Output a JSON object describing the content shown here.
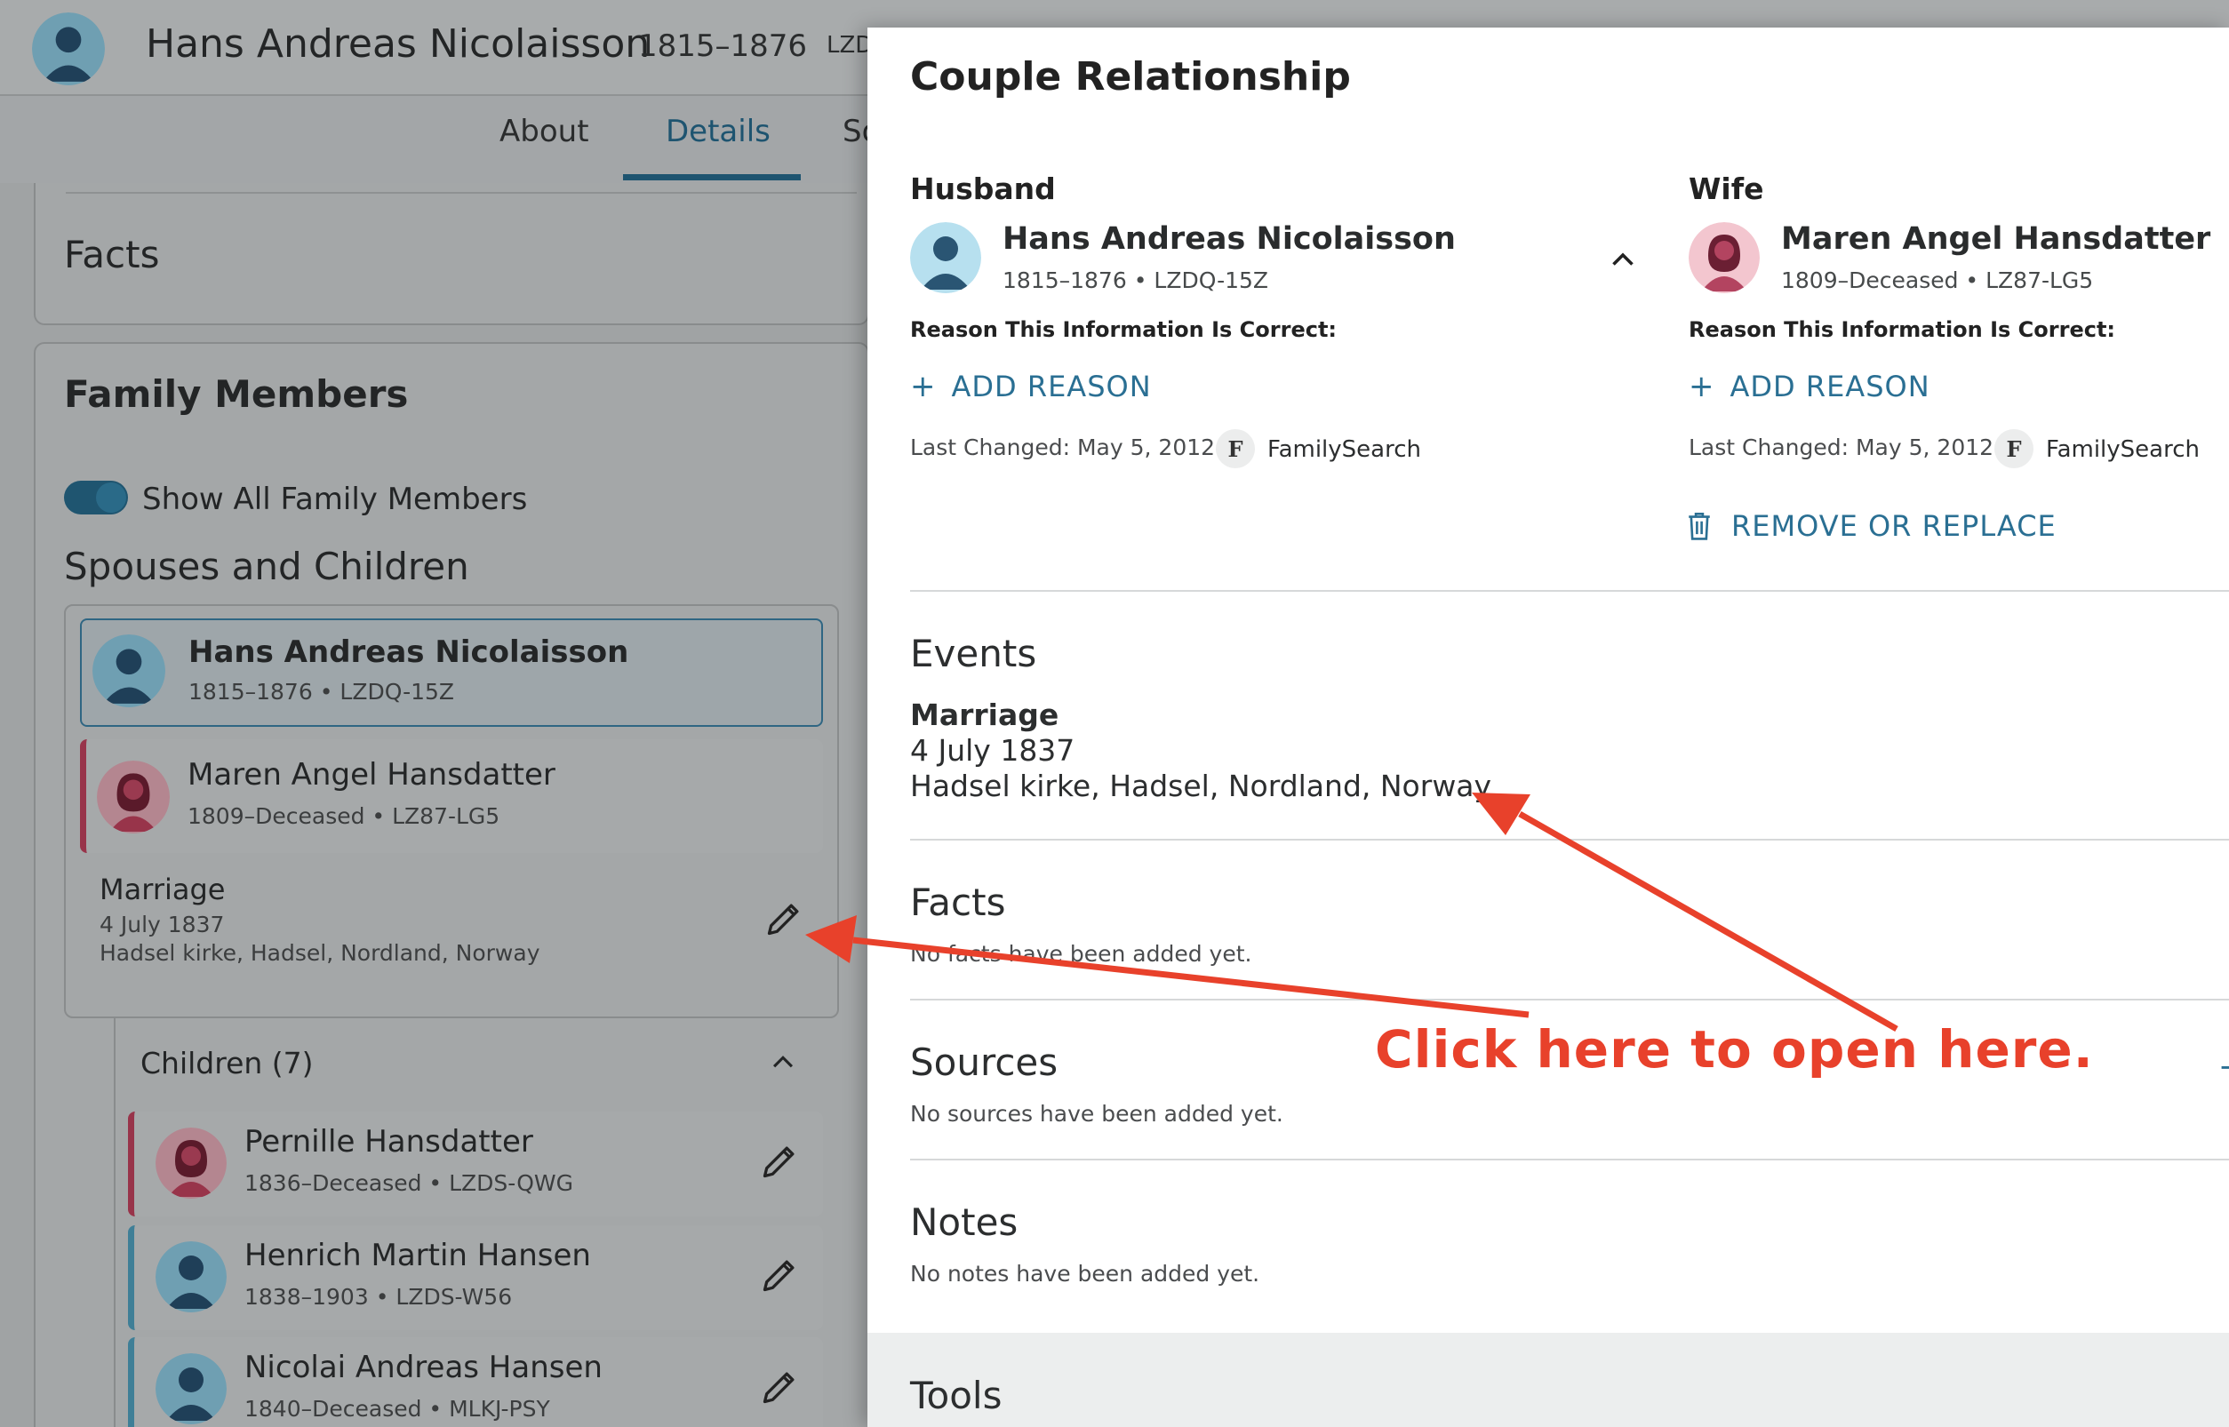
{
  "header": {
    "name": "Hans Andreas Nicolaisson",
    "lifespan": "1815–1876",
    "id_partial": "LZD",
    "tabs": [
      {
        "label": "About"
      },
      {
        "label": "Details"
      },
      {
        "label": "So"
      }
    ]
  },
  "left": {
    "facts_heading": "Facts",
    "family_heading": "Family Members",
    "toggle_label": "Show All Family Members",
    "spouses_heading": "Spouses and Children",
    "husband": {
      "name": "Hans Andreas Nicolaisson",
      "meta": "1815–1876 • LZDQ-15Z"
    },
    "wife": {
      "name": "Maren Angel Hansdatter",
      "meta": "1809–Deceased • LZ87-LG5"
    },
    "marriage": {
      "title": "Marriage",
      "date": "4 July 1837",
      "place": "Hadsel kirke, Hadsel, Nordland, Norway"
    },
    "children_heading": "Children (7)",
    "children": [
      {
        "name": "Pernille Hansdatter",
        "meta": "1836–Deceased • LZDS-QWG"
      },
      {
        "name": "Henrich Martin Hansen",
        "meta": "1838–1903 • LZDS-W56"
      },
      {
        "name": "Nicolai Andreas Hansen",
        "meta": "1840–Deceased • MLKJ-PSY"
      }
    ]
  },
  "dialog": {
    "title": "Couple Relationship",
    "husband": {
      "label": "Husband",
      "name": "Hans Andreas Nicolaisson",
      "meta": "1815–1876 • LZDQ-15Z",
      "reason_label": "Reason This Information Is Correct:",
      "add_reason": "ADD REASON",
      "last_changed": "Last Changed: May 5, 2012",
      "source_initial": "F",
      "source_name": "FamilySearch"
    },
    "wife": {
      "label": "Wife",
      "name": "Maren Angel Hansdatter",
      "meta": "1809–Deceased • LZ87-LG5",
      "reason_label": "Reason This Information Is Correct:",
      "add_reason": "ADD REASON",
      "last_changed": "Last Changed: May 5, 2012",
      "source_initial": "F",
      "source_name": "FamilySearch",
      "remove_label": "REMOVE OR REPLACE"
    },
    "events": {
      "heading": "Events",
      "event_title": "Marriage",
      "event_date": "4 July 1837",
      "event_place": "Hadsel kirke, Hadsel, Nordland, Norway"
    },
    "facts": {
      "heading": "Facts",
      "empty": "No facts have been added yet."
    },
    "sources": {
      "heading": "Sources",
      "empty": "No sources have been added yet."
    },
    "notes": {
      "heading": "Notes",
      "empty": "No notes have been added yet."
    },
    "tools": {
      "heading": "Tools"
    }
  },
  "annotation": {
    "text": "Click here to open here.",
    "color": "#e8412b"
  },
  "colors": {
    "accent": "#2a6f93",
    "female": "#98344a",
    "male": "#3f7f97"
  },
  "icons": [
    "male-avatar-icon",
    "female-avatar-icon",
    "pencil-icon",
    "chevron-up-icon",
    "plus-icon",
    "trash-icon"
  ]
}
